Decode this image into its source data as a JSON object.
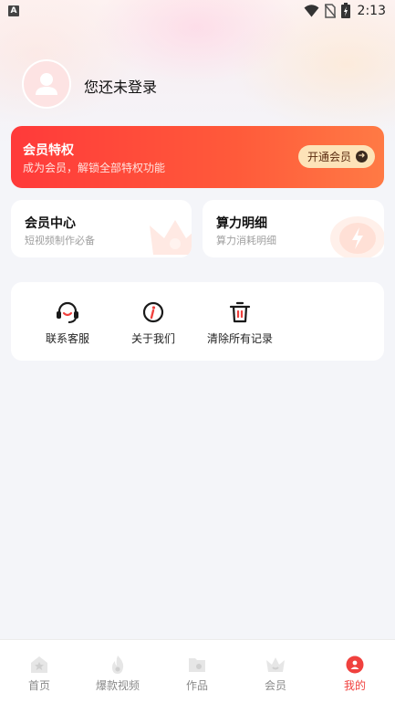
{
  "status_bar": {
    "notification_badge": "A",
    "time": "2:13"
  },
  "profile": {
    "login_text": "您还未登录"
  },
  "vip_banner": {
    "title": "会员特权",
    "subtitle": "成为会员，解锁全部特权功能",
    "button_label": "开通会员",
    "colors": {
      "start": "#ff3a3a",
      "end": "#ff7a45",
      "button_bg": "#fde3b8"
    }
  },
  "cards": [
    {
      "title": "会员中心",
      "subtitle": "短视频制作必备",
      "icon": "crown-icon"
    },
    {
      "title": "算力明细",
      "subtitle": "算力消耗明细",
      "icon": "lightning-icon"
    }
  ],
  "tools": [
    {
      "label": "联系客服",
      "icon": "headset-icon"
    },
    {
      "label": "关于我们",
      "icon": "info-icon"
    },
    {
      "label": "清除所有记录",
      "icon": "trash-icon"
    }
  ],
  "tab_bar": {
    "active_index": 4,
    "active_color": "#f0413e",
    "items": [
      {
        "label": "首页",
        "icon": "home-icon"
      },
      {
        "label": "爆款视频",
        "icon": "fire-icon"
      },
      {
        "label": "作品",
        "icon": "folder-icon"
      },
      {
        "label": "会员",
        "icon": "crown-icon"
      },
      {
        "label": "我的",
        "icon": "profile-icon"
      }
    ]
  }
}
